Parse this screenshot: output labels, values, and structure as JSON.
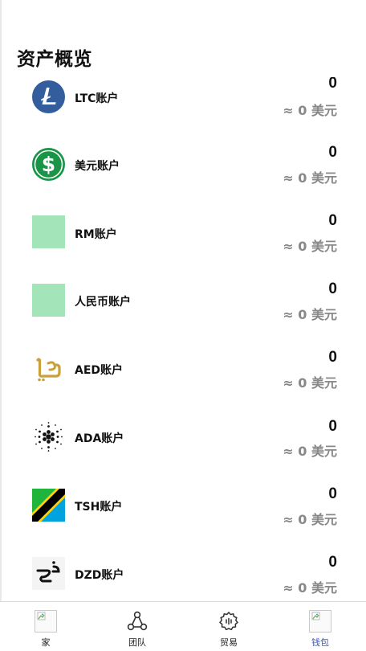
{
  "header": {
    "title": "资产概览"
  },
  "assets": [
    {
      "name": "LTC账户",
      "amount": "0",
      "approx": "≈ 0 美元",
      "icon": "ltc-coin-icon"
    },
    {
      "name": "美元账户",
      "amount": "0",
      "approx": "≈ 0 美元",
      "icon": "dollar-coin-icon"
    },
    {
      "name": "RM账户",
      "amount": "0",
      "approx": "≈ 0 美元",
      "icon": "rm-placeholder-icon"
    },
    {
      "name": "人民币账户",
      "amount": "0",
      "approx": "≈ 0 美元",
      "icon": "rmb-placeholder-icon"
    },
    {
      "name": "AED账户",
      "amount": "0",
      "approx": "≈ 0 美元",
      "icon": "aed-symbol-icon"
    },
    {
      "name": "ADA账户",
      "amount": "0",
      "approx": "≈ 0 美元",
      "icon": "cardano-icon"
    },
    {
      "name": "TSH账户",
      "amount": "0",
      "approx": "≈ 0 美元",
      "icon": "tanzania-flag-icon"
    },
    {
      "name": "DZD账户",
      "amount": "0",
      "approx": "≈ 0 美元",
      "icon": "dzd-symbol-icon"
    }
  ],
  "tabbar": {
    "items": [
      {
        "label": "家",
        "icon": "home-broken-image-icon",
        "active": false
      },
      {
        "label": "团队",
        "icon": "team-icon",
        "active": false
      },
      {
        "label": "贸易",
        "icon": "trade-gear-icon",
        "active": false
      },
      {
        "label": "钱包",
        "icon": "wallet-broken-image-icon",
        "active": true
      }
    ]
  },
  "colors": {
    "ltc": "#345d9d",
    "dollar": "#1a9447",
    "placeholder": "#a3e4b8",
    "aed_gold": "#c9a13a",
    "active_tab": "#3a55b8",
    "muted_text": "#888888"
  }
}
